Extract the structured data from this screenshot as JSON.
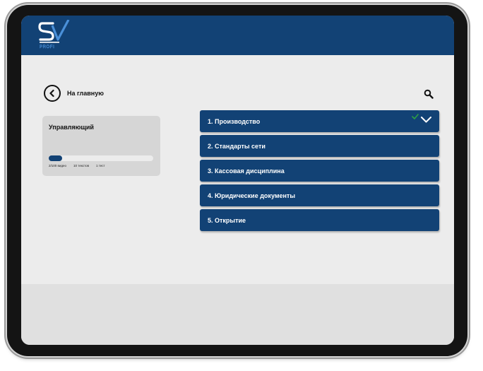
{
  "header": {
    "logo_text": "PROFI"
  },
  "nav": {
    "back_label": "На главную"
  },
  "role_card": {
    "title": "Управляющий",
    "progress_fraction": 0.13,
    "stats": [
      "2/100 видео",
      "10 текстов",
      "1 тест"
    ]
  },
  "modules": [
    {
      "label": "1. Производство",
      "completed": true,
      "expanded_toggle": true
    },
    {
      "label": "2. Стандарты сети"
    },
    {
      "label": "3. Кассовая дисциплина"
    },
    {
      "label": "4. Юридические документы"
    },
    {
      "label": "5. Открытие"
    }
  ],
  "colors": {
    "primary": "#124275",
    "check": "#2ea043",
    "background": "#ececec",
    "card": "#d6d6d6"
  },
  "icons": {
    "back": "back-arrow-circle-icon",
    "search": "search-icon",
    "check": "check-icon",
    "chevron": "chevron-down-icon"
  }
}
